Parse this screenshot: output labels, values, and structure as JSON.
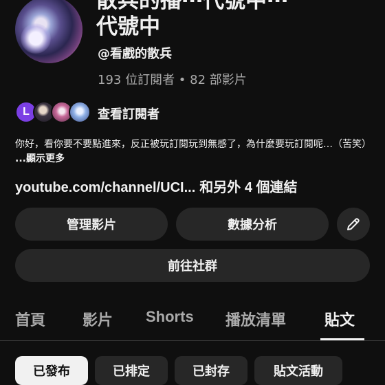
{
  "channel": {
    "title_line1": "散兵的播⋯代號中⋯",
    "title_line2": "代號中",
    "handle": "@看戲的散兵",
    "stats": "193 位訂閱者 • 82 部影片",
    "subscriber_avatar_letter": "L",
    "view_subscribers": "查看訂閱者",
    "description": "你好，看你要不要點進來，反正被玩訂閱玩到無感了，為什麼要玩訂閱呢…（苦笑）",
    "description_more": "...顯示更多",
    "link": "youtube.com/channel/UCI...",
    "link_extra": "和另外 4 個連結"
  },
  "actions": {
    "manage_videos": "管理影片",
    "analytics": "數據分析",
    "edit_icon": "pencil-icon",
    "go_community": "前往社群"
  },
  "tabs": [
    {
      "label": "首頁"
    },
    {
      "label": "影片"
    },
    {
      "label": "Shorts"
    },
    {
      "label": "播放清單"
    },
    {
      "label": "貼文"
    }
  ],
  "active_tab": "貼文",
  "chips": [
    {
      "label": "已發布"
    },
    {
      "label": "已排定"
    },
    {
      "label": "已封存"
    },
    {
      "label": "貼文活動"
    }
  ],
  "selected_chip": "已發布",
  "colors": {
    "background": "#0f0f0f",
    "button": "#272727",
    "text": "#f1f1f1",
    "muted": "#aaaaaa",
    "avatar_letter_bg": "#7b3fe4"
  }
}
